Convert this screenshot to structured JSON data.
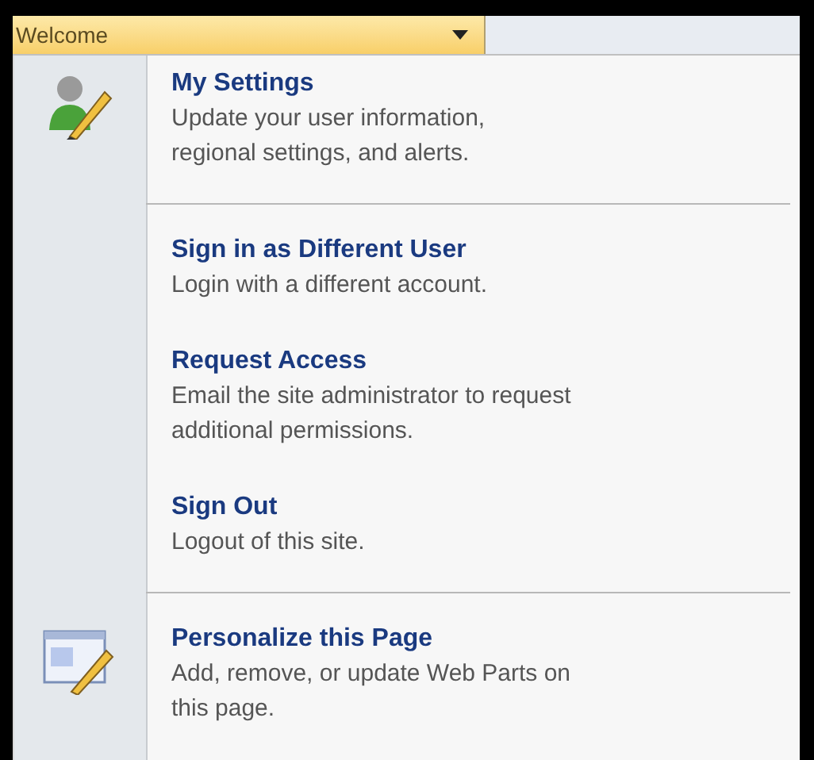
{
  "welcome_button": {
    "label": "Welcome"
  },
  "menu_items": [
    {
      "kind": "profile",
      "title": "My Settings",
      "description": "Update your user information,\nregional settings, and alerts.",
      "divider_after": true
    },
    {
      "kind": "plain",
      "title": "Sign in as Different User",
      "description": "Login with a different account.",
      "divider_after": false
    },
    {
      "kind": "plain",
      "title": "Request Access",
      "description": "Email the site administrator to request\nadditional permissions.",
      "divider_after": false
    },
    {
      "kind": "plain",
      "title": "Sign Out",
      "description": "Logout of this site.",
      "divider_after": true
    },
    {
      "kind": "page",
      "title": "Personalize this Page",
      "description": "Add, remove, or update Web Parts on\nthis page.",
      "divider_after": false
    }
  ]
}
